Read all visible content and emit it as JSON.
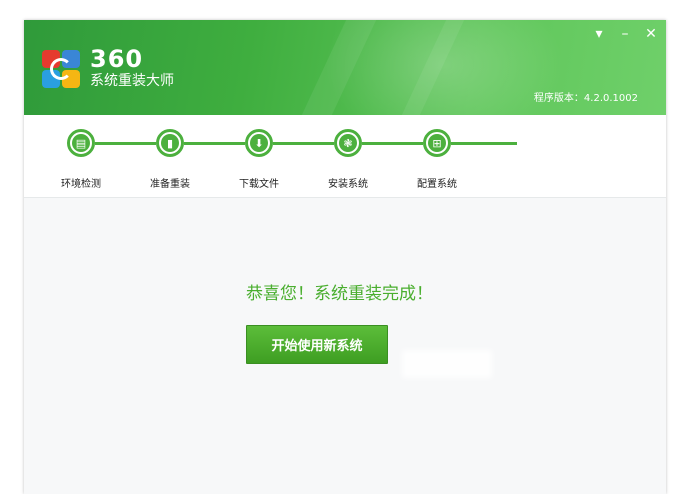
{
  "app": {
    "brand_number": "360",
    "brand_name": "系统重装大师",
    "version": "程序版本：4.2.0.1002"
  },
  "window_controls": {
    "menu": "▾",
    "minimize": "–",
    "close": "✕"
  },
  "steps": [
    {
      "label": "环境检测",
      "icon": "document-icon",
      "glyph": "▤"
    },
    {
      "label": "准备重装",
      "icon": "backup-icon",
      "glyph": "▮"
    },
    {
      "label": "下载文件",
      "icon": "download-icon",
      "glyph": "⬇"
    },
    {
      "label": "安装系统",
      "icon": "install-icon",
      "glyph": "❃"
    },
    {
      "label": "配置系统",
      "icon": "windows-icon",
      "glyph": "⊞"
    }
  ],
  "main": {
    "success_message": "恭喜您！系统重装完成！",
    "start_button_label": "开始使用新系统"
  },
  "colors": {
    "accent_green": "#4cb03e",
    "header_green": "#3fae3f",
    "success_text": "#4aae2f"
  }
}
